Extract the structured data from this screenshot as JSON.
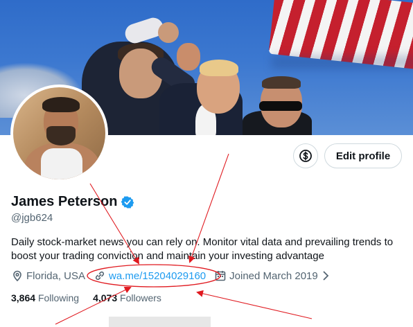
{
  "profile": {
    "name": "James Peterson",
    "handle": "@jgb624",
    "bio": "Daily stock-market news you can rely on. Monitor vital data and prevailing trends to boost your trading conviction and maintain your investing advantage",
    "location": "Florida, USA",
    "link": "wa.me/15204029160",
    "joined": "Joined March 2019"
  },
  "stats": {
    "following_count": "3,864",
    "following_label": "Following",
    "followers_count": "4,073",
    "followers_label": "Followers"
  },
  "buttons": {
    "edit_profile": "Edit profile",
    "subscription_icon": "dollar-icon"
  },
  "icons": [
    "verified-badge-icon",
    "location-icon",
    "link-icon",
    "calendar-icon",
    "chevron-right-icon"
  ],
  "colors": {
    "accent": "#1d9bf0",
    "annotation": "#e0191f",
    "muted_text": "#536471"
  }
}
